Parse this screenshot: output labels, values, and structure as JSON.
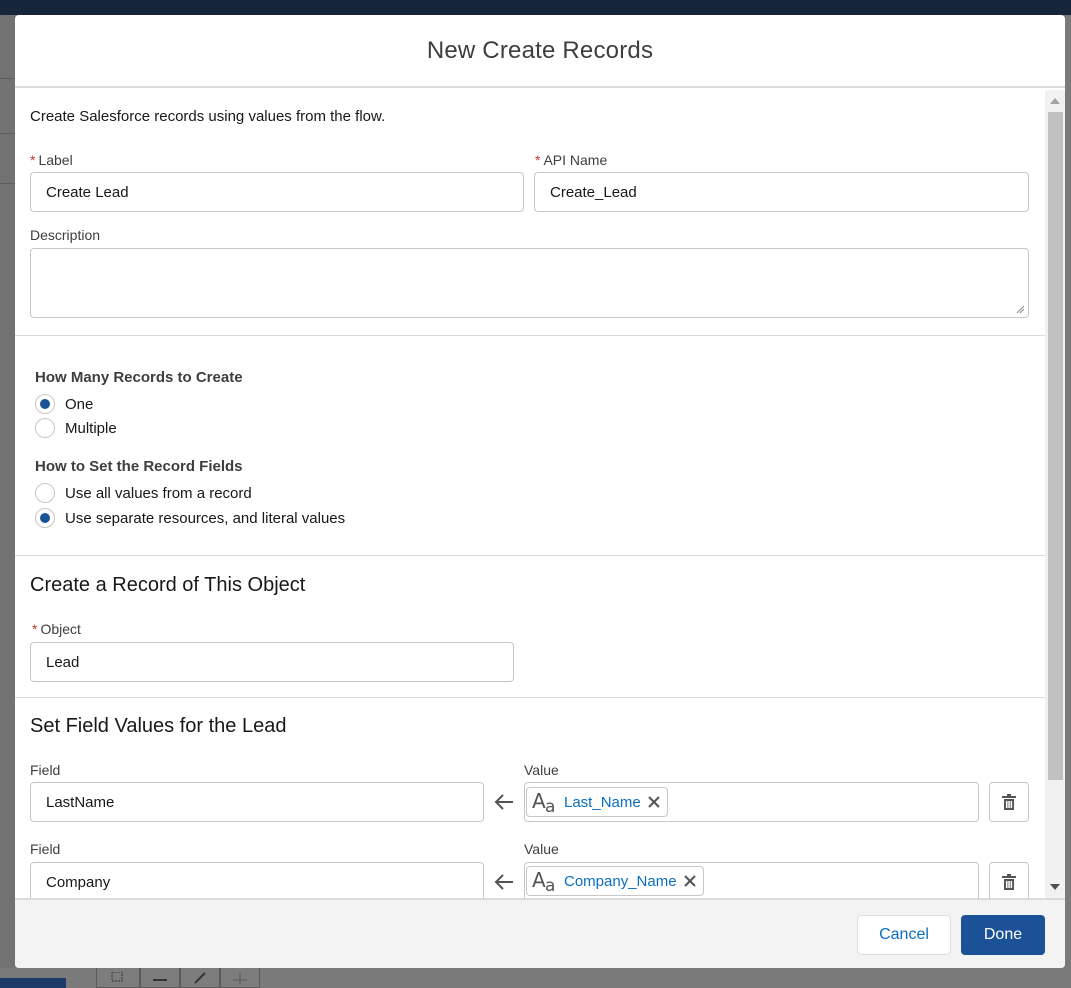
{
  "modal": {
    "title": "New Create Records",
    "intro": "Create Salesforce records using values from the flow."
  },
  "fields": {
    "label": {
      "label": "Label",
      "value": "Create Lead"
    },
    "api_name": {
      "label": "API Name",
      "value": "Create_Lead"
    },
    "description": {
      "label": "Description",
      "value": ""
    }
  },
  "how_many": {
    "title": "How Many Records to Create",
    "options": [
      {
        "label": "One",
        "checked": true
      },
      {
        "label": "Multiple",
        "checked": false
      }
    ]
  },
  "how_to_set": {
    "title": "How to Set the Record Fields",
    "options": [
      {
        "label": "Use all values from a record",
        "checked": false
      },
      {
        "label": "Use separate resources, and literal values",
        "checked": true
      }
    ]
  },
  "object_section": {
    "title": "Create a Record of This Object",
    "object_label": "Object",
    "object_value": "Lead"
  },
  "field_values": {
    "title": "Set Field Values for the Lead",
    "rows": [
      {
        "field_label": "Field",
        "field_value": "LastName",
        "value_label": "Value",
        "value": "Last_Name"
      },
      {
        "field_label": "Field",
        "field_value": "Company",
        "value_label": "Value",
        "value": "Company_Name"
      }
    ]
  },
  "footer": {
    "cancel": "Cancel",
    "done": "Done"
  },
  "colors": {
    "brand": "#1b5297",
    "link": "#0b6ec1",
    "required": "#c23934"
  }
}
